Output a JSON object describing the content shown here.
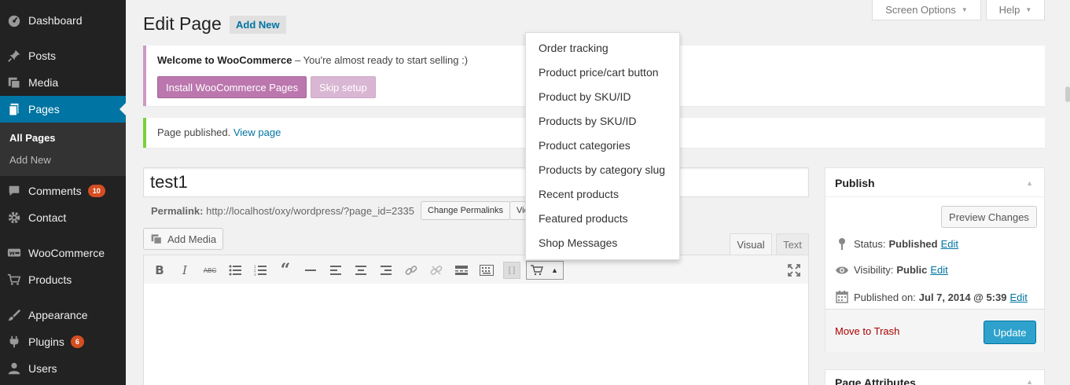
{
  "sidebar": {
    "items": [
      {
        "label": "Dashboard",
        "icon": "dashboard-icon"
      },
      {
        "label": "Posts",
        "icon": "pin-icon"
      },
      {
        "label": "Media",
        "icon": "media-icon"
      },
      {
        "label": "Pages",
        "icon": "pages-icon"
      },
      {
        "label": "Comments",
        "icon": "comment-icon",
        "badge": "10"
      },
      {
        "label": "Contact",
        "icon": "gear-icon"
      },
      {
        "label": "WooCommerce",
        "icon": "woocommerce-icon"
      },
      {
        "label": "Products",
        "icon": "cart-icon"
      },
      {
        "label": "Appearance",
        "icon": "brush-icon"
      },
      {
        "label": "Plugins",
        "icon": "plug-icon",
        "badge": "6"
      },
      {
        "label": "Users",
        "icon": "user-icon"
      }
    ],
    "submenu": [
      {
        "label": "All Pages"
      },
      {
        "label": "Add New"
      }
    ]
  },
  "top": {
    "screen_options": "Screen Options",
    "help": "Help"
  },
  "header": {
    "title": "Edit Page",
    "add_new": "Add New"
  },
  "woo_notice": {
    "strong": "Welcome to WooCommerce",
    "text": " – You're almost ready to start selling :)",
    "install_button": "Install WooCommerce Pages",
    "skip_button": "Skip setup"
  },
  "published_notice": {
    "text": "Page published. ",
    "link": "View page"
  },
  "editor": {
    "title_value": "test1",
    "permalink_label": "Permalink:",
    "permalink_url": " http://localhost/oxy/wordpress/?page_id=2335",
    "change_permalinks": "Change Permalinks",
    "view_page_button": "View Page",
    "add_media": "Add Media",
    "tab_visual": "Visual",
    "tab_text": "Text"
  },
  "shortcode_menu": {
    "items": [
      "Order tracking",
      "Product price/cart button",
      "Product by SKU/ID",
      "Products by SKU/ID",
      "Product categories",
      "Products by category slug",
      "Recent products",
      "Featured products",
      "Shop Messages"
    ]
  },
  "publish": {
    "title": "Publish",
    "preview_button": "Preview Changes",
    "status_label": "Status:",
    "status_value": "Published",
    "visibility_label": "Visibility:",
    "visibility_value": "Public",
    "published_label": "Published on:",
    "published_value": "Jul 7, 2014 @ 5:39",
    "edit_link": "Edit",
    "trash_link": "Move to Trash",
    "update_button": "Update"
  },
  "page_attributes": {
    "title": "Page Attributes"
  },
  "colors": {
    "admin_bar": "#222222",
    "accent": "#0074a2",
    "woo_purple": "#bb77ae",
    "update_blue": "#2ea2cc",
    "success_green": "#7ad03a"
  }
}
